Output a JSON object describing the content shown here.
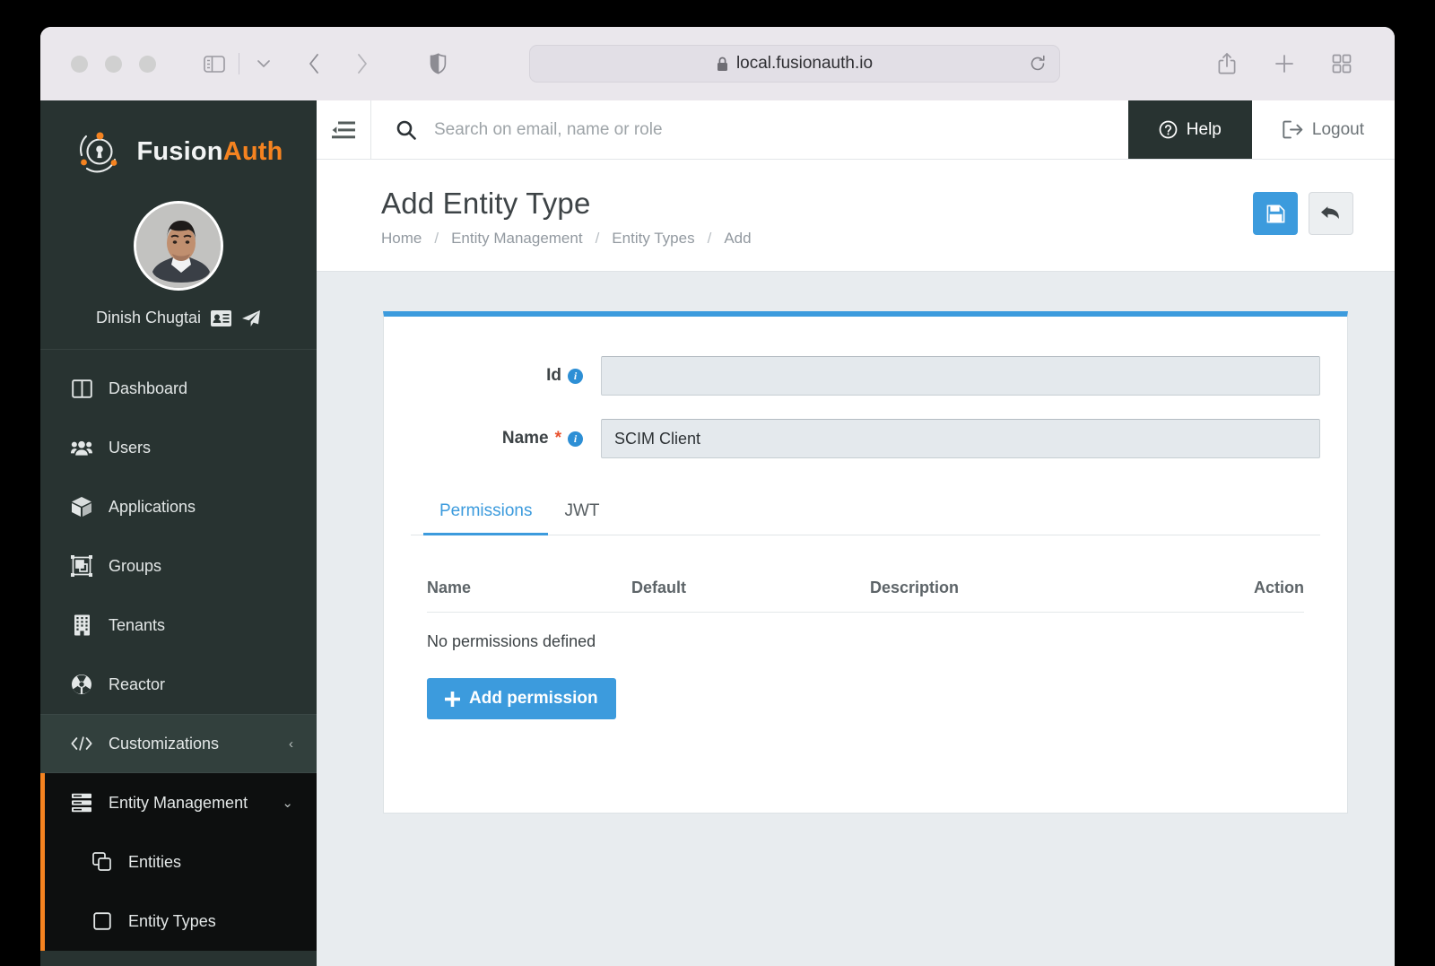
{
  "browser": {
    "url": "local.fusionauth.io",
    "lock_icon": "lock-icon",
    "shield_icon": "shield-icon",
    "reload_icon": "reload-icon",
    "back_icon": "back-arrow-icon",
    "forward_icon": "forward-arrow-icon",
    "sidebar_icon": "sidebar-toggle-icon",
    "share_icon": "share-icon",
    "newtab_icon": "plus-icon",
    "tabs_icon": "tab-overview-icon"
  },
  "sidebar": {
    "brand": {
      "first": "Fusion",
      "second": "Auth"
    },
    "user": {
      "name": "Dinish Chugtai",
      "card_icon": "id-card-icon",
      "send_icon": "paper-plane-icon"
    },
    "items": [
      {
        "label": "Dashboard",
        "icon": "dashboard-icon"
      },
      {
        "label": "Users",
        "icon": "users-icon"
      },
      {
        "label": "Applications",
        "icon": "box-icon"
      },
      {
        "label": "Groups",
        "icon": "groups-icon"
      },
      {
        "label": "Tenants",
        "icon": "building-icon"
      },
      {
        "label": "Reactor",
        "icon": "reactor-icon"
      },
      {
        "label": "Customizations",
        "icon": "code-icon",
        "chevron": "‹"
      },
      {
        "label": "Entity Management",
        "icon": "server-icon",
        "chevron": "⌄"
      }
    ],
    "subitems": [
      {
        "label": "Entities",
        "icon": "copy-icon"
      },
      {
        "label": "Entity Types",
        "icon": "square-icon"
      }
    ]
  },
  "topbar": {
    "menu_icon": "hamburger-icon",
    "search_icon": "search-icon",
    "search_placeholder": "Search on email, name or role",
    "search_value": "",
    "help_label": "Help",
    "help_icon": "question-circle-icon",
    "logout_label": "Logout",
    "logout_icon": "sign-out-icon"
  },
  "page": {
    "title": "Add Entity Type",
    "breadcrumbs": [
      {
        "label": "Home"
      },
      {
        "label": "Entity Management"
      },
      {
        "label": "Entity Types"
      },
      {
        "label": "Add"
      }
    ],
    "separator": "/",
    "save_icon": "save-floppy-icon",
    "back_icon": "undo-arrow-icon"
  },
  "form": {
    "id": {
      "label": "Id",
      "value": "",
      "required": false,
      "info_icon": "info-icon"
    },
    "name": {
      "label": "Name",
      "value": "SCIM Client",
      "required": true,
      "required_mark": "*",
      "info_icon": "info-icon"
    }
  },
  "tabs": [
    {
      "label": "Permissions",
      "active": true
    },
    {
      "label": "JWT",
      "active": false
    }
  ],
  "table": {
    "headers": {
      "name": "Name",
      "default": "Default",
      "description": "Description",
      "action": "Action"
    },
    "rows": [],
    "empty_text": "No permissions defined"
  },
  "actions": {
    "add_permission_label": "Add permission",
    "add_permission_icon": "plus-icon"
  },
  "colors": {
    "accent_blue": "#3c9bdd",
    "brand_orange": "#f58320",
    "sidebar_dark": "#283331",
    "submenu_dark": "#0d0f0f",
    "page_bg": "#e8ecef",
    "required_red": "#e8522f"
  }
}
